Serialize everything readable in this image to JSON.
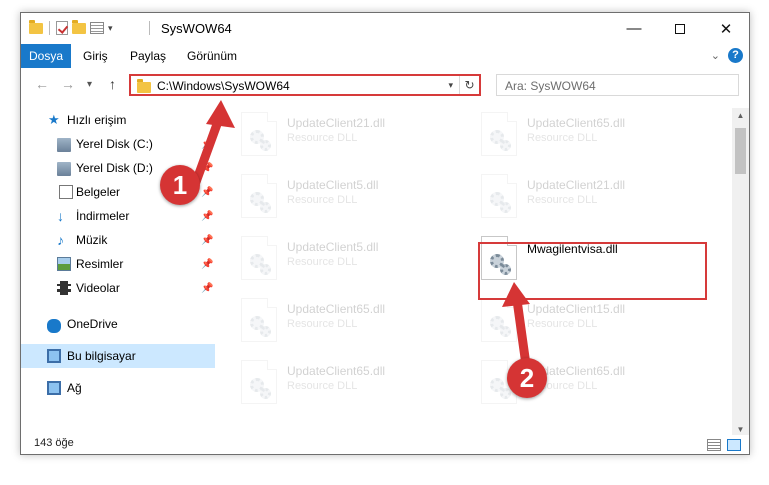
{
  "window": {
    "title": "SysWOW64",
    "minimize_glyph": "—",
    "close_glyph": "✕"
  },
  "ribbon": {
    "tabs": [
      "Dosya",
      "Giriş",
      "Paylaş",
      "Görünüm"
    ],
    "help_glyph": "?"
  },
  "nav": {
    "address": "C:\\Windows\\SysWOW64",
    "search_placeholder": "Ara: SysWOW64"
  },
  "sidebar": {
    "items": [
      {
        "label": "Hızlı erişim",
        "icon": "star-icon",
        "pinned": false
      },
      {
        "label": "Yerel Disk (C:)",
        "icon": "disk-icon",
        "pinned": true
      },
      {
        "label": "Yerel Disk (D:)",
        "icon": "disk-icon",
        "pinned": true
      },
      {
        "label": "Belgeler",
        "icon": "document-icon",
        "pinned": true
      },
      {
        "label": "İndirmeler",
        "icon": "download-icon",
        "pinned": true
      },
      {
        "label": "Müzik",
        "icon": "music-icon",
        "pinned": true
      },
      {
        "label": "Resimler",
        "icon": "pictures-icon",
        "pinned": true
      },
      {
        "label": "Videolar",
        "icon": "video-icon",
        "pinned": true
      },
      {
        "label": "OneDrive",
        "icon": "cloud-icon",
        "pinned": false
      },
      {
        "label": "Bu bilgisayar",
        "icon": "computer-icon",
        "pinned": false,
        "selected": true
      },
      {
        "label": "Ağ",
        "icon": "network-icon",
        "pinned": false
      }
    ]
  },
  "files": [
    {
      "name": "UpdateClient21.dll",
      "type": "Resource DLL",
      "faded": true
    },
    {
      "name": "UpdateClient65.dll",
      "type": "Resource DLL",
      "faded": true
    },
    {
      "name": "UpdateClient5.dll",
      "type": "Resource DLL",
      "faded": true
    },
    {
      "name": "UpdateClient21.dll",
      "type": "Resource DLL",
      "faded": true
    },
    {
      "name": "UpdateClient5.dll",
      "type": "Resource DLL",
      "faded": true
    },
    {
      "name": "Mwagilentvisa.dll",
      "type": "",
      "faded": false
    },
    {
      "name": "UpdateClient65.dll",
      "type": "Resource DLL",
      "faded": true
    },
    {
      "name": "UpdateClient15.dll",
      "type": "Resource DLL",
      "faded": true
    },
    {
      "name": "UpdateClient65.dll",
      "type": "Resource DLL",
      "faded": true
    },
    {
      "name": "UpdateClient65.dll",
      "type": "Resource DLL",
      "faded": true
    }
  ],
  "status": {
    "item_count": "143 öğe"
  },
  "annotations": {
    "step1": "1",
    "step2": "2",
    "color": "#d53434"
  }
}
